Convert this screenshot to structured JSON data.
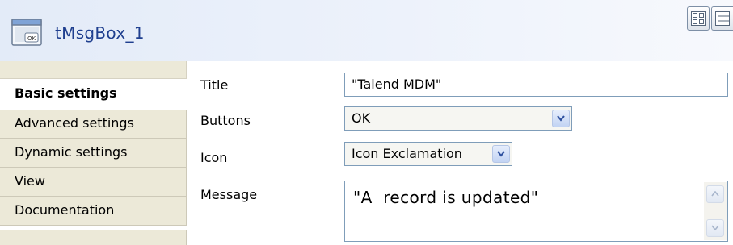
{
  "header": {
    "title": "tMsgBox_1"
  },
  "sidebar": {
    "items": [
      {
        "label": "Basic settings",
        "active": true
      },
      {
        "label": "Advanced settings",
        "active": false
      },
      {
        "label": "Dynamic settings",
        "active": false
      },
      {
        "label": "View",
        "active": false
      },
      {
        "label": "Documentation",
        "active": false
      }
    ]
  },
  "form": {
    "title": {
      "label": "Title",
      "value": "\"Talend MDM\""
    },
    "buttons": {
      "label": "Buttons",
      "value": "OK"
    },
    "icon": {
      "label": "Icon",
      "value": "Icon Exclamation"
    },
    "message": {
      "label": "Message",
      "value": "\"A  record is updated\""
    }
  },
  "icons": {
    "component": "msgbox-component-icon",
    "layout_grid": "grid-layout-icon",
    "layout_list": "list-layout-icon",
    "dropdown": "chevron-down-icon",
    "scroll_up": "scroll-up-icon",
    "scroll_down": "scroll-down-icon"
  },
  "colors": {
    "title_text": "#1f3f8f",
    "sidebar_bg": "#ece9d8",
    "field_border": "#7f9db9"
  }
}
